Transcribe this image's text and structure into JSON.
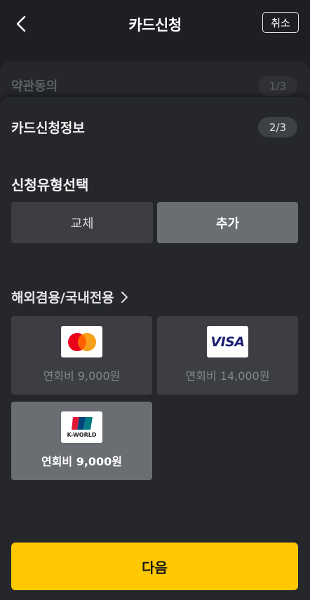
{
  "header": {
    "title": "카드신청",
    "cancel_label": "취소"
  },
  "steps": [
    {
      "label": "약관동의",
      "badge": "1/3"
    },
    {
      "label": "카드신청정보",
      "badge": "2/3"
    }
  ],
  "apply_type": {
    "title": "신청유형선택",
    "options": [
      {
        "label": "교체",
        "selected": false
      },
      {
        "label": "추가",
        "selected": true
      }
    ]
  },
  "usage": {
    "title": "해외겸용/국내전용",
    "cards": [
      {
        "brand": "mastercard",
        "logo_icon": "mastercard-logo-icon",
        "fee": "연회비 9,000원",
        "selected": false
      },
      {
        "brand": "visa",
        "logo_icon": "visa-logo-icon",
        "logo_text": "VISA",
        "fee": "연회비 14,000원",
        "selected": false
      },
      {
        "brand": "unionpay-kworld",
        "logo_icon": "unionpay-kworld-logo-icon",
        "logo_text": "K-WORLD",
        "fee": "연회비 9,000원",
        "selected": true
      }
    ]
  },
  "next_label": "다음",
  "colors": {
    "background": "#1e1f22",
    "panel": "#25272a",
    "option": "#3c3e43",
    "option_selected": "#6a6d72",
    "accent": "#ffc800"
  }
}
